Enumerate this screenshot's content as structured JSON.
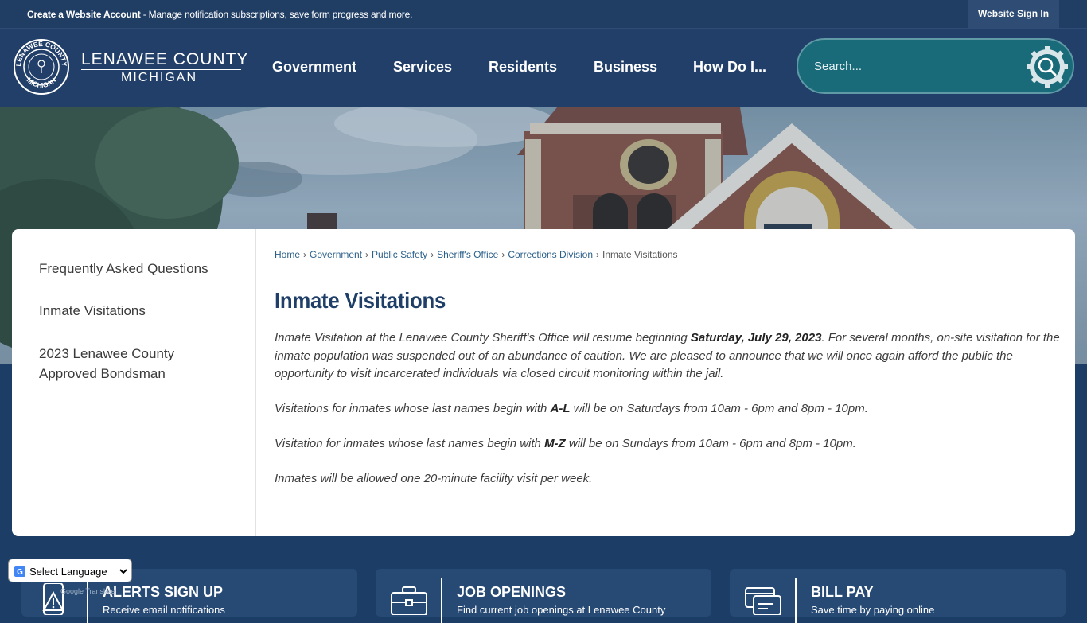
{
  "topbar": {
    "create_account_label": "Create a Website Account",
    "create_account_desc": " - Manage notification subscriptions, save form progress and more.",
    "sign_in_label": "Website Sign In"
  },
  "brand": {
    "line1": "LENAWEE COUNTY",
    "line2": "MICHIGAN",
    "seal_top_text": "LENAWEE COUNTY",
    "seal_bottom_text": "MICHIGAN"
  },
  "nav": {
    "items": [
      {
        "label": "Government"
      },
      {
        "label": "Services"
      },
      {
        "label": "Residents"
      },
      {
        "label": "Business"
      },
      {
        "label": "How Do I..."
      }
    ]
  },
  "search": {
    "placeholder": "Search..."
  },
  "sidebar": {
    "items": [
      {
        "label": "Frequently Asked Questions"
      },
      {
        "label": "Inmate Visitations"
      },
      {
        "label": "2023 Lenawee County Approved Bondsman"
      }
    ]
  },
  "breadcrumb": [
    {
      "label": "Home"
    },
    {
      "label": "Government"
    },
    {
      "label": "Public Safety"
    },
    {
      "label": "Sheriff's Office"
    },
    {
      "label": "Corrections Division"
    },
    {
      "label": "Inmate Visitations"
    }
  ],
  "page": {
    "title": "Inmate Visitations",
    "p1_before": "Inmate Visitation at the Lenawee County Sheriff's Office will resume beginning ",
    "p1_bold": "Saturday, July 29, 2023",
    "p1_after": ".  For several months, on-site visitation for the inmate population was suspended out of an abundance of caution.  We are pleased to announce that we will once again afford the public the opportunity to visit incarcerated individuals via closed circuit monitoring within the jail.",
    "p2_before": "Visitations for inmates whose last names begin with ",
    "p2_bold": "A-L",
    "p2_after": " will be on Saturdays from 10am - 6pm and 8pm - 10pm.",
    "p3_before": "Visitation for inmates whose last names begin with ",
    "p3_bold": "M-Z",
    "p3_after": " will be on Sundays from 10am - 6pm and 8pm - 10pm.",
    "p4": "Inmates will be allowed one 20-minute facility visit per week."
  },
  "quick_links": [
    {
      "title": "ALERTS SIGN UP",
      "subtitle": "Receive email notifications",
      "icon": "phone-alert-icon"
    },
    {
      "title": "JOB OPENINGS",
      "subtitle": "Find current job openings at Lenawee County",
      "icon": "briefcase-icon"
    },
    {
      "title": "BILL PAY",
      "subtitle": "Save time by paying online",
      "icon": "bill-pay-icon"
    }
  ],
  "translate": {
    "select_label": "Select Language",
    "powered_by": "Google Translate"
  },
  "colors": {
    "header_bg": "#213f68",
    "search_bg": "#1a6b7a",
    "title": "#1f3f68",
    "link": "#2a5f8a"
  }
}
